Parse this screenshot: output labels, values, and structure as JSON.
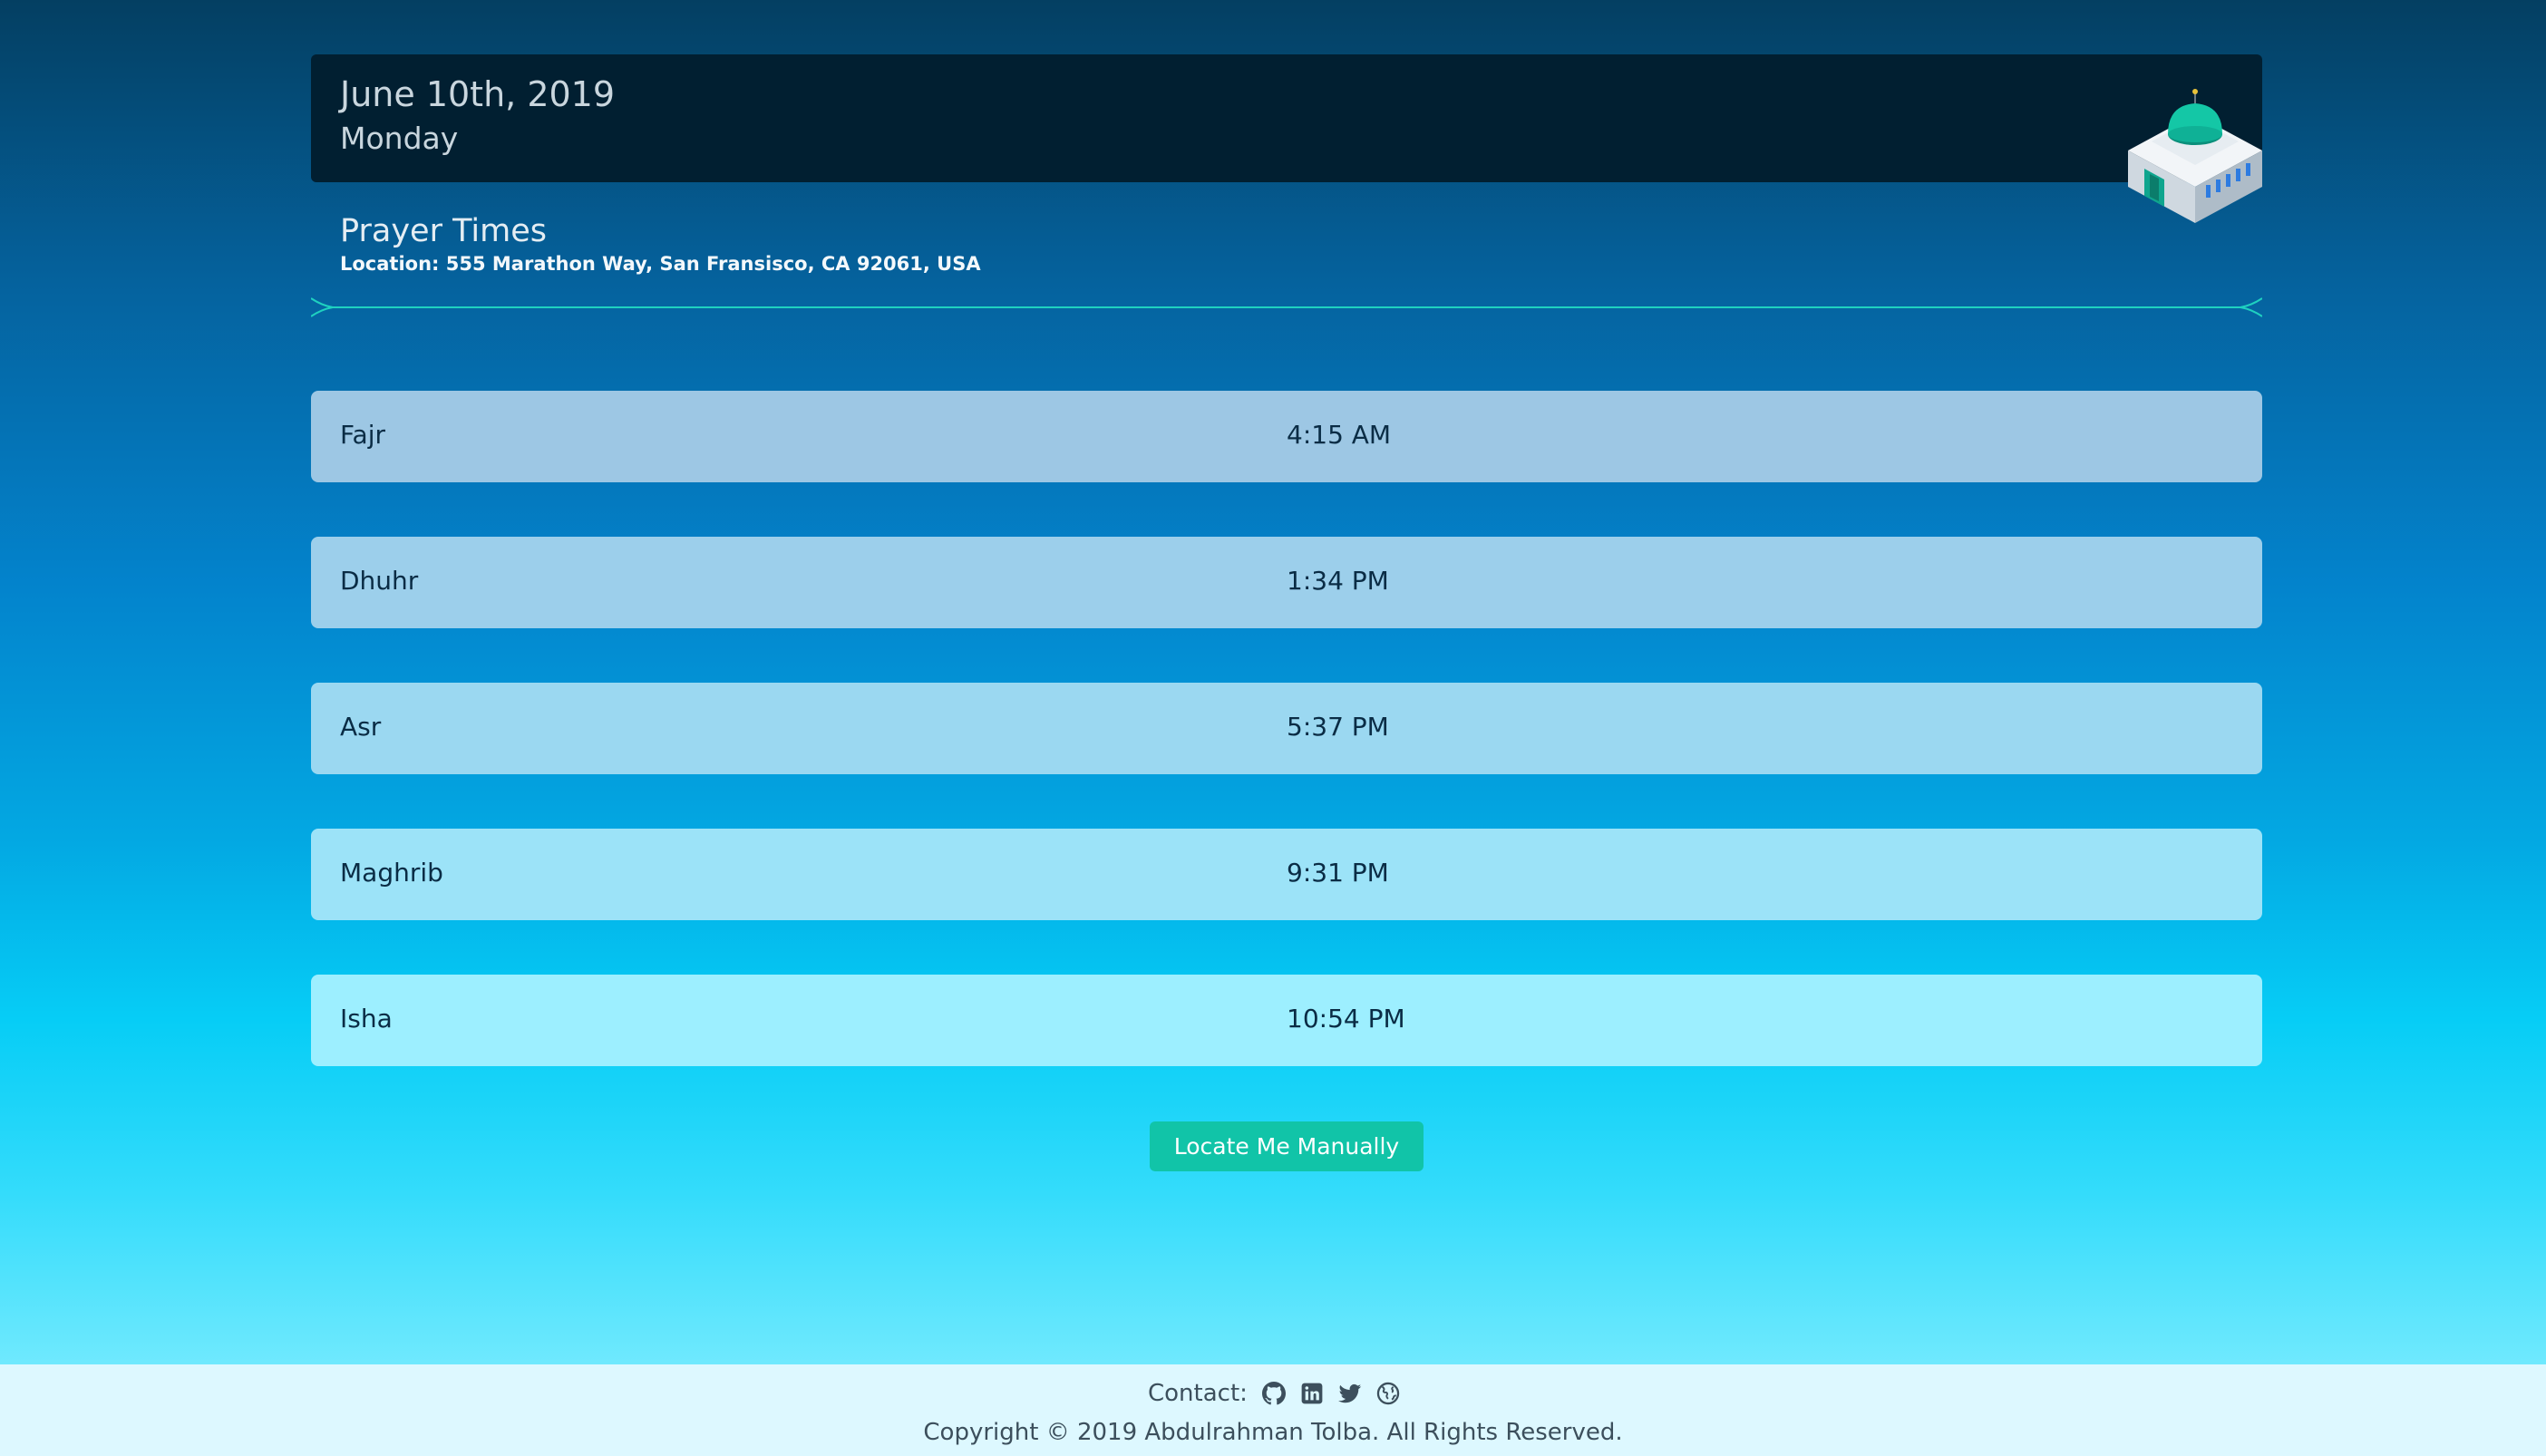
{
  "header": {
    "date": "June 10th, 2019",
    "weekday": "Monday",
    "logo_icon": "mosque-icon"
  },
  "info": {
    "title": "Prayer Times",
    "location": "Location: 555 Marathon Way, San Fransisco, CA 92061, USA"
  },
  "prayers": [
    {
      "name": "Fajr",
      "time": "4:15 AM",
      "color": "#9dc7e4"
    },
    {
      "name": "Dhuhr",
      "time": "1:34 PM",
      "color": "#9ccfeb"
    },
    {
      "name": "Asr",
      "time": "5:37 PM",
      "color": "#9bd8f1"
    },
    {
      "name": "Maghrib",
      "time": "9:31 PM",
      "color": "#9ce3f8"
    },
    {
      "name": "Isha",
      "time": "10:54 PM",
      "color": "#9defff"
    }
  ],
  "actions": {
    "locate_label": "Locate Me Manually"
  },
  "footer": {
    "contact_label": "Contact:",
    "icons": [
      "github-icon",
      "linkedin-icon",
      "twitter-icon",
      "globe-icon"
    ],
    "copyright": "Copyright © 2019 Abdulrahman Tolba. All Rights Reserved."
  },
  "colors": {
    "header_bg": "#011f31",
    "accent": "#11c4a8",
    "divider": "#1fd1c0",
    "footer_bg": "#ddf8ff"
  }
}
